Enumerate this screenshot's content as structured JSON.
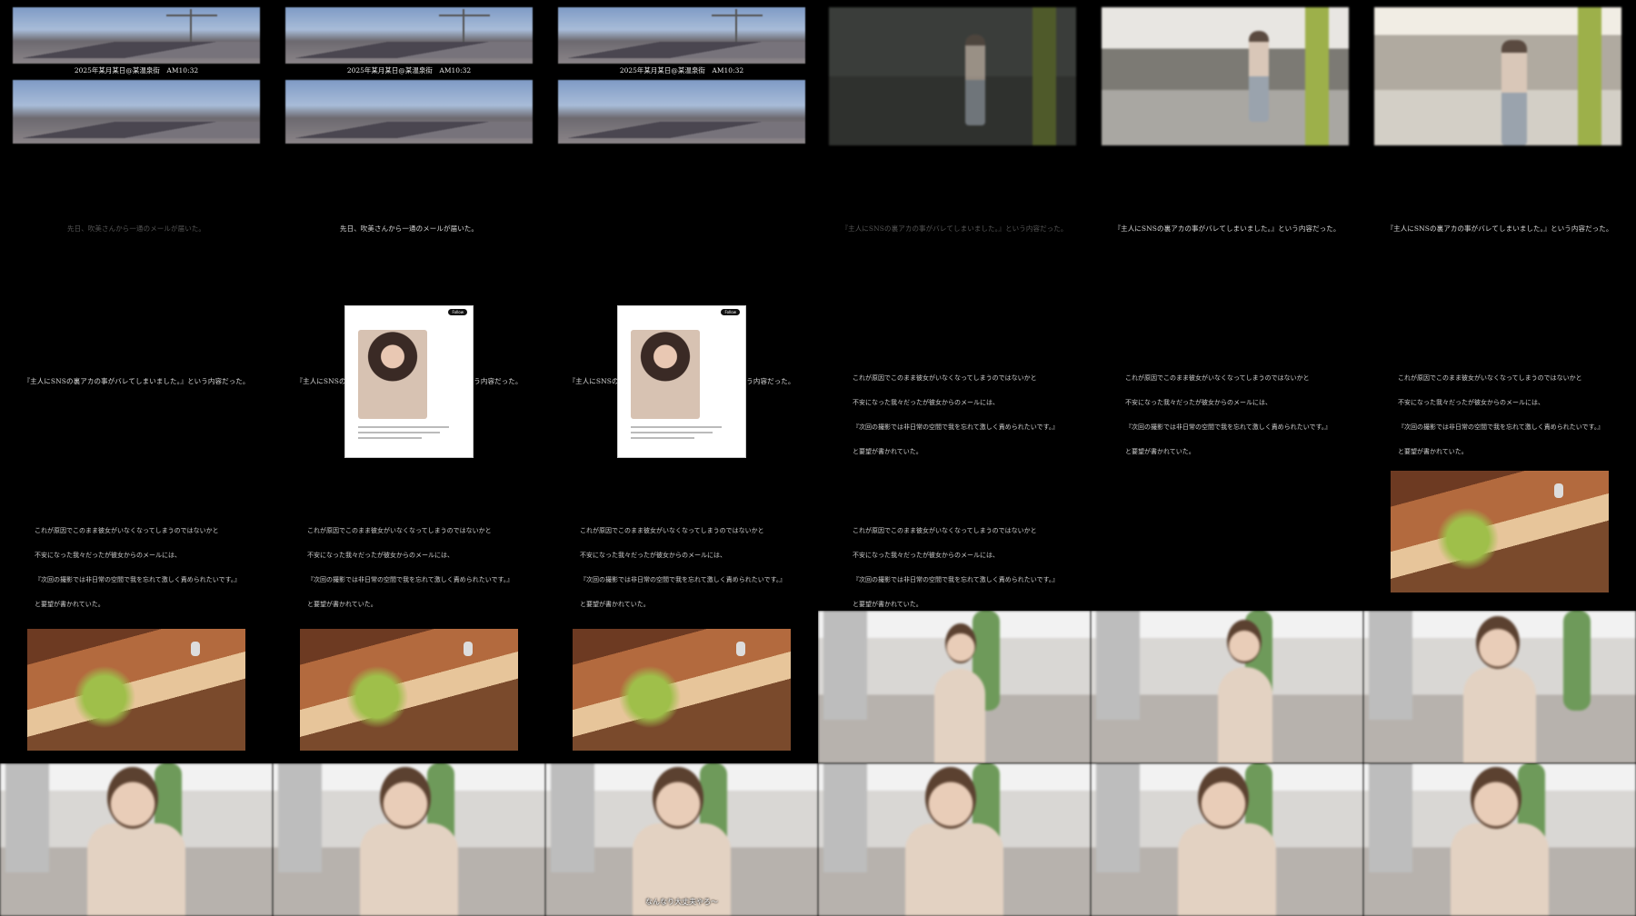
{
  "thumb_sheet": {
    "watermark": "",
    "street_timestamp": "2025年某月某日@某温泉街　AM10:32",
    "caption_mail": "先日、吹美さんから一通のメールが届いた。",
    "caption_content": "『主人にSNSの裏アカの事がバレてしまいました。』という内容だった。",
    "paragraph_lines": [
      "これが原因でこのまま彼女がいなくなってしまうのではないかと",
      "不安になった我々だったが彼女からのメールには、",
      "『次回の撮影では非日常の空間で我を忘れて激しく責められたいです。』",
      "と要望が書かれていた。"
    ],
    "phone_follow_label": "Follow",
    "temple_overlay": "",
    "subtitle_bottom": "なんなり大丈夫やろ〜"
  },
  "colors": {
    "background": "#000000",
    "caption_text": "#d8d8d8"
  }
}
